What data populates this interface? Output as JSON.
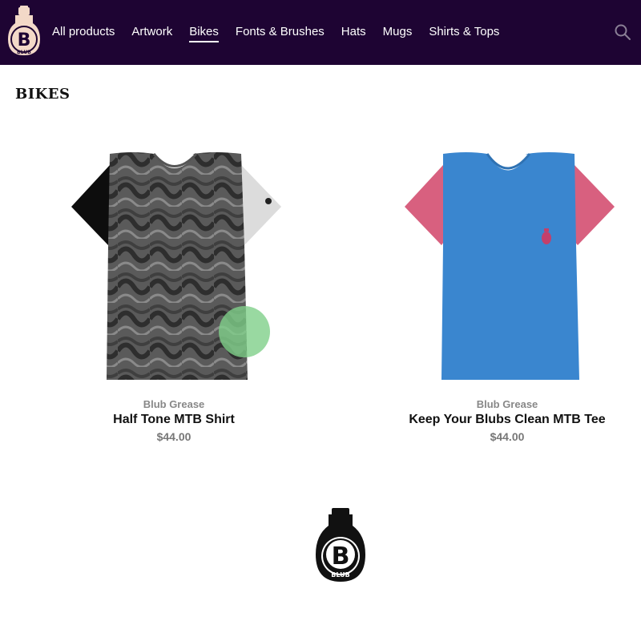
{
  "header": {
    "logo_text": "BLUB",
    "nav": [
      {
        "label": "All products"
      },
      {
        "label": "Artwork"
      },
      {
        "label": "Bikes",
        "active": true
      },
      {
        "label": "Fonts & Brushes"
      },
      {
        "label": "Hats"
      },
      {
        "label": "Mugs"
      },
      {
        "label": "Shirts & Tops"
      }
    ],
    "icons": {
      "search": "search-icon",
      "logo": "blub-bulb-logo"
    }
  },
  "page": {
    "title": "BIKES"
  },
  "products": [
    {
      "brand": "Blub Grease",
      "name": "Half Tone MTB Shirt",
      "price": "$44.00"
    },
    {
      "brand": "Blub Grease",
      "name": "Keep Your Blubs Clean MTB Tee",
      "price": "$44.00"
    }
  ],
  "footer": {
    "logo_text": "BLUB"
  },
  "colors": {
    "header_bg": "#1e0433",
    "tee_blue": "#3a86cf",
    "tee_pink": "#d8607f"
  }
}
